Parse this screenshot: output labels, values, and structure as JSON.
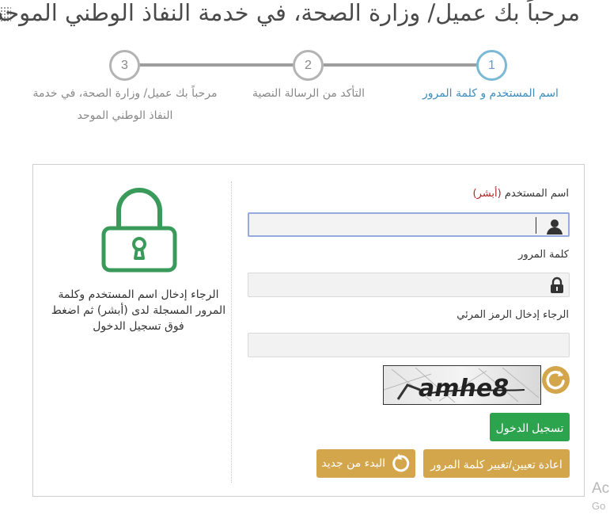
{
  "header": {
    "title": "مرحباً بك عميل/ وزارة الصحة، في خدمة النفاذ الوطني الموحد"
  },
  "steps": [
    {
      "number": "1",
      "label": "اسم المستخدم و كلمة المرور",
      "active": true
    },
    {
      "number": "2",
      "label": "التأكد من الرسالة النصية",
      "active": false
    },
    {
      "number": "3",
      "label": "مرحباً بك عميل/ وزارة الصحة، في خدمة النفاذ الوطني الموحد",
      "active": false
    }
  ],
  "info": {
    "text": "الرجاء إدخال اسم المستخدم وكلمة المرور المسجلة لدى (أبشر) ثم اضغط فوق تسجيل الدخول"
  },
  "form": {
    "username_label": "اسم المستخدم",
    "username_note": "(أبشر)",
    "username_value": "",
    "password_label": "كلمة المرور",
    "password_value": "",
    "captcha_label": "الرجاء إدخال الرمز المرئي",
    "captcha_value": "",
    "captcha_text": "amhe8"
  },
  "buttons": {
    "login": "تسجيل الدخول",
    "reset_password": "اعادة تعيين/تغيير كلمة المرور",
    "restart": "البدء من جديد"
  },
  "watermark": {
    "line1": "Ac",
    "line2": "Go"
  },
  "colors": {
    "accent": "#3c8dbc",
    "green": "#2ca34d",
    "gold": "#d4a64b"
  }
}
